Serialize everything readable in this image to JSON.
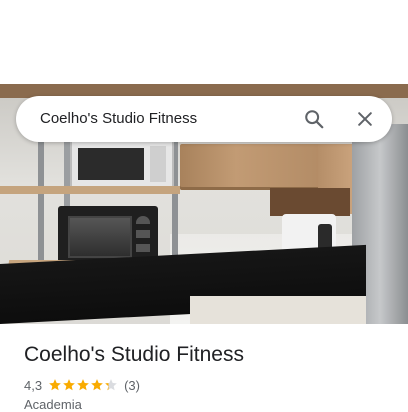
{
  "search": {
    "query": "Coelho's Studio Fitness"
  },
  "place": {
    "name": "Coelho's Studio Fitness",
    "rating": "4,3",
    "rating_value": 4.3,
    "max_stars": 5,
    "review_count": "(3)",
    "category": "Academia"
  },
  "icons": {
    "search": "search-icon",
    "close": "close-icon",
    "star": "star-icon"
  },
  "colors": {
    "star": "#f9ab00",
    "star_empty": "#dadce0",
    "text_primary": "#202124",
    "text_secondary": "#5f6368",
    "icon": "#5f6368"
  }
}
